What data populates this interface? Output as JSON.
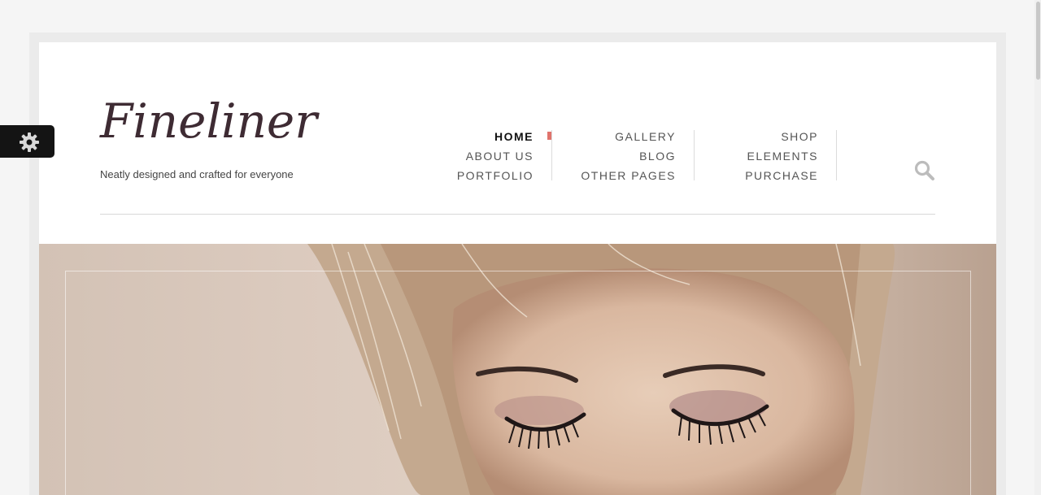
{
  "brand": {
    "logo": "Fineliner",
    "tagline": "Neatly designed and crafted for everyone"
  },
  "nav": {
    "col1": [
      "HOME",
      "ABOUT US",
      "PORTFOLIO"
    ],
    "col2": [
      "GALLERY",
      "BLOG",
      "OTHER PAGES"
    ],
    "col3": [
      "SHOP",
      "ELEMENTS",
      "PURCHASE"
    ],
    "active": "HOME"
  },
  "icons": {
    "search": "search-icon",
    "settings": "gear-icon"
  },
  "colors": {
    "accent": "#e0736c",
    "logo": "#3e2b33",
    "settings_tab": "#141414"
  }
}
